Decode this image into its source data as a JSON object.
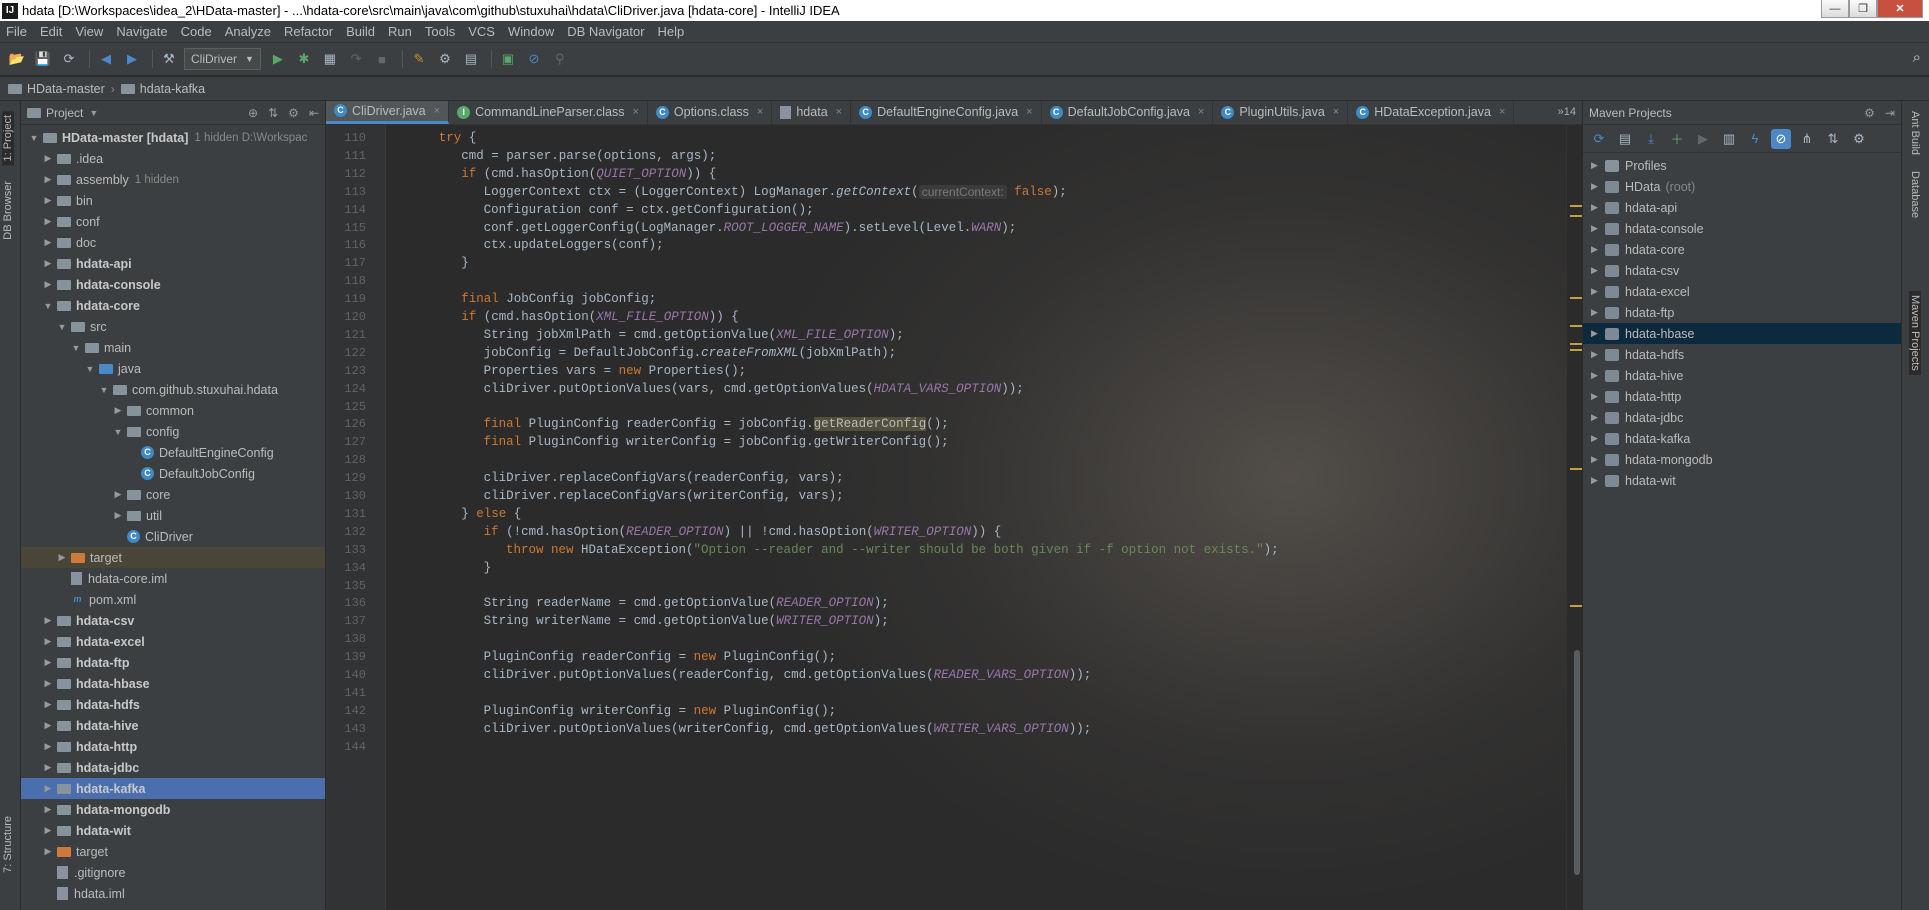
{
  "window": {
    "title": "hdata [D:\\Workspaces\\idea_2\\HData-master] - ...\\hdata-core\\src\\main\\java\\com\\github\\stuxuhai\\hdata\\CliDriver.java [hdata-core] - IntelliJ IDEA",
    "app_icon": "IJ",
    "minimize": "—",
    "maximize": "❐",
    "close": "✕"
  },
  "menu": [
    "File",
    "Edit",
    "View",
    "Navigate",
    "Code",
    "Analyze",
    "Refactor",
    "Build",
    "Run",
    "Tools",
    "VCS",
    "Window",
    "DB Navigator",
    "Help"
  ],
  "toolbar": {
    "run_config": "CliDriver",
    "icons": [
      "open-folder-icon",
      "save-icon",
      "sync-icon",
      "back-arrow-icon",
      "forward-arrow-icon",
      "build-icon",
      "run-icon",
      "debug-icon",
      "coverage-icon",
      "profile-icon",
      "stop-icon",
      "vcs-update-icon",
      "vcs-commit-icon",
      "project-structure-icon",
      "sdk-icon",
      "terminal-icon"
    ],
    "search_glyph": "⌕"
  },
  "breadcrumb": [
    "HData-master",
    "hdata-kafka"
  ],
  "left_strip": {
    "project_tab": "1: Project",
    "db_browser": "DB Browser",
    "structure": "7: Structure"
  },
  "project": {
    "header": "Project",
    "tree": [
      {
        "label": "HData-master [hdata]",
        "meta": "1 hidden  D:\\Workspac",
        "indent": 0,
        "arrow": "▼",
        "bold": true,
        "icon": "folder"
      },
      {
        "label": ".idea",
        "indent": 1,
        "arrow": "▶",
        "icon": "folder"
      },
      {
        "label": "assembly",
        "meta": "1 hidden",
        "indent": 1,
        "arrow": "▶",
        "icon": "folder"
      },
      {
        "label": "bin",
        "indent": 1,
        "arrow": "▶",
        "icon": "folder"
      },
      {
        "label": "conf",
        "indent": 1,
        "arrow": "▶",
        "icon": "folder"
      },
      {
        "label": "doc",
        "indent": 1,
        "arrow": "▶",
        "icon": "folder"
      },
      {
        "label": "hdata-api",
        "indent": 1,
        "arrow": "▶",
        "bold": true,
        "icon": "folder"
      },
      {
        "label": "hdata-console",
        "indent": 1,
        "arrow": "▶",
        "bold": true,
        "icon": "folder"
      },
      {
        "label": "hdata-core",
        "indent": 1,
        "arrow": "▼",
        "bold": true,
        "icon": "folder"
      },
      {
        "label": "src",
        "indent": 2,
        "arrow": "▼",
        "icon": "folder"
      },
      {
        "label": "main",
        "indent": 3,
        "arrow": "▼",
        "icon": "folder"
      },
      {
        "label": "java",
        "indent": 4,
        "arrow": "▼",
        "icon": "folder-blue"
      },
      {
        "label": "com.github.stuxuhai.hdata",
        "indent": 5,
        "arrow": "▼",
        "icon": "folder"
      },
      {
        "label": "common",
        "indent": 6,
        "arrow": "▶",
        "icon": "folder"
      },
      {
        "label": "config",
        "indent": 6,
        "arrow": "▼",
        "icon": "folder"
      },
      {
        "label": "DefaultEngineConfig",
        "indent": 7,
        "arrow": "",
        "icon": "class"
      },
      {
        "label": "DefaultJobConfig",
        "indent": 7,
        "arrow": "",
        "icon": "class"
      },
      {
        "label": "core",
        "indent": 6,
        "arrow": "▶",
        "icon": "folder"
      },
      {
        "label": "util",
        "indent": 6,
        "arrow": "▶",
        "icon": "folder"
      },
      {
        "label": "CliDriver",
        "indent": 6,
        "arrow": "",
        "icon": "class"
      },
      {
        "label": "target",
        "indent": 2,
        "arrow": "▶",
        "icon": "folder-orange",
        "state": "target"
      },
      {
        "label": "hdata-core.iml",
        "indent": 2,
        "arrow": "",
        "icon": "file"
      },
      {
        "label": "pom.xml",
        "indent": 2,
        "arrow": "",
        "icon": "maven"
      },
      {
        "label": "hdata-csv",
        "indent": 1,
        "arrow": "▶",
        "bold": true,
        "icon": "folder"
      },
      {
        "label": "hdata-excel",
        "indent": 1,
        "arrow": "▶",
        "bold": true,
        "icon": "folder"
      },
      {
        "label": "hdata-ftp",
        "indent": 1,
        "arrow": "▶",
        "bold": true,
        "icon": "folder"
      },
      {
        "label": "hdata-hbase",
        "indent": 1,
        "arrow": "▶",
        "bold": true,
        "icon": "folder"
      },
      {
        "label": "hdata-hdfs",
        "indent": 1,
        "arrow": "▶",
        "bold": true,
        "icon": "folder"
      },
      {
        "label": "hdata-hive",
        "indent": 1,
        "arrow": "▶",
        "bold": true,
        "icon": "folder"
      },
      {
        "label": "hdata-http",
        "indent": 1,
        "arrow": "▶",
        "bold": true,
        "icon": "folder"
      },
      {
        "label": "hdata-jdbc",
        "indent": 1,
        "arrow": "▶",
        "bold": true,
        "icon": "folder"
      },
      {
        "label": "hdata-kafka",
        "indent": 1,
        "arrow": "▶",
        "bold": true,
        "icon": "folder",
        "state": "selected"
      },
      {
        "label": "hdata-mongodb",
        "indent": 1,
        "arrow": "▶",
        "bold": true,
        "icon": "folder"
      },
      {
        "label": "hdata-wit",
        "indent": 1,
        "arrow": "▶",
        "bold": true,
        "icon": "folder"
      },
      {
        "label": "target",
        "indent": 1,
        "arrow": "▶",
        "icon": "folder-orange"
      },
      {
        "label": ".gitignore",
        "indent": 1,
        "arrow": "",
        "icon": "file"
      },
      {
        "label": "hdata.iml",
        "indent": 1,
        "arrow": "",
        "icon": "file"
      }
    ]
  },
  "tabs": [
    {
      "label": "CliDriver.java",
      "active": true,
      "icon": "class"
    },
    {
      "label": "CommandLineParser.class",
      "icon": "interface"
    },
    {
      "label": "Options.class",
      "icon": "class"
    },
    {
      "label": "hdata",
      "icon": "file"
    },
    {
      "label": "DefaultEngineConfig.java",
      "icon": "class"
    },
    {
      "label": "DefaultJobConfig.java",
      "icon": "class"
    },
    {
      "label": "PluginUtils.java",
      "icon": "class"
    },
    {
      "label": "HDataException.java",
      "icon": "class"
    }
  ],
  "tabs_overflow": "»14",
  "editor": {
    "lines": [
      {
        "n": "110",
        "indent": 4,
        "tokens": [
          [
            "kw",
            "try"
          ],
          [
            "plain",
            " {"
          ]
        ]
      },
      {
        "n": "111",
        "indent": 6,
        "tokens": [
          [
            "plain",
            "cmd = parser.parse(options, args);"
          ]
        ]
      },
      {
        "n": "112",
        "indent": 6,
        "tokens": [
          [
            "kw",
            "if"
          ],
          [
            "plain",
            " (cmd.hasOption("
          ],
          [
            "cn",
            "QUIET_OPTION"
          ],
          [
            "plain",
            ")) {"
          ]
        ]
      },
      {
        "n": "113",
        "indent": 8,
        "tokens": [
          [
            "plain",
            "LoggerContext ctx = (LoggerContext) LogManager."
          ],
          [
            "fn",
            "getContext"
          ],
          [
            "plain",
            "("
          ],
          [
            "hint",
            "currentContext:"
          ],
          [
            "kw",
            " false"
          ],
          [
            "plain",
            ");"
          ]
        ]
      },
      {
        "n": "114",
        "indent": 8,
        "tokens": [
          [
            "plain",
            "Configuration conf = ctx.getConfiguration();"
          ]
        ]
      },
      {
        "n": "115",
        "indent": 8,
        "tokens": [
          [
            "plain",
            "conf.getLoggerConfig(LogManager."
          ],
          [
            "cn",
            "ROOT_LOGGER_NAME"
          ],
          [
            "plain",
            ").setLevel(Level."
          ],
          [
            "cn",
            "WARN"
          ],
          [
            "plain",
            ");"
          ]
        ]
      },
      {
        "n": "116",
        "indent": 8,
        "tokens": [
          [
            "plain",
            "ctx.updateLoggers(conf);"
          ]
        ]
      },
      {
        "n": "117",
        "indent": 6,
        "tokens": [
          [
            "plain",
            "}"
          ]
        ]
      },
      {
        "n": "118",
        "indent": 0,
        "tokens": []
      },
      {
        "n": "119",
        "indent": 6,
        "tokens": [
          [
            "kw",
            "final"
          ],
          [
            "plain",
            " JobConfig jobConfig;"
          ]
        ]
      },
      {
        "n": "120",
        "indent": 6,
        "tokens": [
          [
            "kw",
            "if"
          ],
          [
            "plain",
            " (cmd.hasOption("
          ],
          [
            "cn",
            "XML_FILE_OPTION"
          ],
          [
            "plain",
            ")) {"
          ]
        ]
      },
      {
        "n": "121",
        "indent": 8,
        "tokens": [
          [
            "plain",
            "String jobXmlPath = cmd.getOptionValue("
          ],
          [
            "cn",
            "XML_FILE_OPTION"
          ],
          [
            "plain",
            ");"
          ]
        ]
      },
      {
        "n": "122",
        "indent": 8,
        "tokens": [
          [
            "plain",
            "jobConfig = DefaultJobConfig."
          ],
          [
            "fn",
            "createFromXML"
          ],
          [
            "plain",
            "(jobXmlPath);"
          ]
        ]
      },
      {
        "n": "123",
        "indent": 8,
        "tokens": [
          [
            "plain",
            "Properties vars = "
          ],
          [
            "kw",
            "new"
          ],
          [
            "plain",
            " Properties();"
          ]
        ]
      },
      {
        "n": "124",
        "indent": 8,
        "tokens": [
          [
            "plain",
            "cliDriver.putOptionValues(vars, cmd.getOptionValues("
          ],
          [
            "cn",
            "HDATA_VARS_OPTION"
          ],
          [
            "plain",
            "));"
          ]
        ]
      },
      {
        "n": "125",
        "indent": 0,
        "tokens": []
      },
      {
        "n": "126",
        "indent": 8,
        "tokens": [
          [
            "kw",
            "final"
          ],
          [
            "plain",
            " PluginConfig readerConfig = jobConfig."
          ],
          [
            "hl",
            "getReaderConfig"
          ],
          [
            "plain",
            "();"
          ]
        ]
      },
      {
        "n": "127",
        "indent": 8,
        "tokens": [
          [
            "kw",
            "final"
          ],
          [
            "plain",
            " PluginConfig writerConfig = jobConfig.getWriterConfig();"
          ]
        ]
      },
      {
        "n": "128",
        "indent": 0,
        "tokens": []
      },
      {
        "n": "129",
        "indent": 8,
        "tokens": [
          [
            "plain",
            "cliDriver.replaceConfigVars(readerConfig, vars);"
          ]
        ]
      },
      {
        "n": "130",
        "indent": 8,
        "tokens": [
          [
            "plain",
            "cliDriver.replaceConfigVars(writerConfig, vars);"
          ]
        ]
      },
      {
        "n": "131",
        "indent": 6,
        "tokens": [
          [
            "plain",
            "} "
          ],
          [
            "kw",
            "else"
          ],
          [
            "plain",
            " {"
          ]
        ]
      },
      {
        "n": "132",
        "indent": 8,
        "tokens": [
          [
            "kw",
            "if"
          ],
          [
            "plain",
            " (!cmd.hasOption("
          ],
          [
            "cn",
            "READER_OPTION"
          ],
          [
            "plain",
            ") || !cmd.hasOption("
          ],
          [
            "cn",
            "WRITER_OPTION"
          ],
          [
            "plain",
            ")) {"
          ]
        ]
      },
      {
        "n": "133",
        "indent": 10,
        "tokens": [
          [
            "kw",
            "throw new"
          ],
          [
            "plain",
            " HDataException("
          ],
          [
            "str",
            "\"Option --reader and --writer should be both given if -f option not exists.\""
          ],
          [
            "plain",
            ");"
          ]
        ]
      },
      {
        "n": "134",
        "indent": 8,
        "tokens": [
          [
            "plain",
            "}"
          ]
        ]
      },
      {
        "n": "135",
        "indent": 0,
        "tokens": []
      },
      {
        "n": "136",
        "indent": 8,
        "tokens": [
          [
            "plain",
            "String readerName = cmd.getOptionValue("
          ],
          [
            "cn",
            "READER_OPTION"
          ],
          [
            "plain",
            ");"
          ]
        ]
      },
      {
        "n": "137",
        "indent": 8,
        "tokens": [
          [
            "plain",
            "String writerName = cmd.getOptionValue("
          ],
          [
            "cn",
            "WRITER_OPTION"
          ],
          [
            "plain",
            ");"
          ]
        ]
      },
      {
        "n": "138",
        "indent": 0,
        "tokens": []
      },
      {
        "n": "139",
        "indent": 8,
        "tokens": [
          [
            "plain",
            "PluginConfig readerConfig = "
          ],
          [
            "kw",
            "new"
          ],
          [
            "plain",
            " PluginConfig();"
          ]
        ]
      },
      {
        "n": "140",
        "indent": 8,
        "tokens": [
          [
            "plain",
            "cliDriver.putOptionValues(readerConfig, cmd.getOptionValues("
          ],
          [
            "cn",
            "READER_VARS_OPTION"
          ],
          [
            "plain",
            "));"
          ]
        ]
      },
      {
        "n": "141",
        "indent": 0,
        "tokens": []
      },
      {
        "n": "142",
        "indent": 8,
        "tokens": [
          [
            "plain",
            "PluginConfig writerConfig = "
          ],
          [
            "kw",
            "new"
          ],
          [
            "plain",
            " PluginConfig();"
          ]
        ]
      },
      {
        "n": "143",
        "indent": 8,
        "tokens": [
          [
            "plain",
            "cliDriver.putOptionValues(writerConfig, cmd.getOptionValues("
          ],
          [
            "cn",
            "WRITER_VARS_OPTION"
          ],
          [
            "plain",
            "));"
          ]
        ]
      },
      {
        "n": "144",
        "indent": 0,
        "tokens": []
      }
    ]
  },
  "maven": {
    "header": "Maven Projects",
    "items": [
      {
        "label": "Profiles",
        "arrow": "▶",
        "icon": "folder"
      },
      {
        "label": "HData",
        "meta": "(root)",
        "arrow": "▶",
        "icon": "maven"
      },
      {
        "label": "hdata-api",
        "arrow": "▶",
        "icon": "maven"
      },
      {
        "label": "hdata-console",
        "arrow": "▶",
        "icon": "maven"
      },
      {
        "label": "hdata-core",
        "arrow": "▶",
        "icon": "maven"
      },
      {
        "label": "hdata-csv",
        "arrow": "▶",
        "icon": "maven"
      },
      {
        "label": "hdata-excel",
        "arrow": "▶",
        "icon": "maven"
      },
      {
        "label": "hdata-ftp",
        "arrow": "▶",
        "icon": "maven"
      },
      {
        "label": "hdata-hbase",
        "arrow": "▶",
        "icon": "maven",
        "selected": true
      },
      {
        "label": "hdata-hdfs",
        "arrow": "▶",
        "icon": "maven"
      },
      {
        "label": "hdata-hive",
        "arrow": "▶",
        "icon": "maven"
      },
      {
        "label": "hdata-http",
        "arrow": "▶",
        "icon": "maven"
      },
      {
        "label": "hdata-jdbc",
        "arrow": "▶",
        "icon": "maven"
      },
      {
        "label": "hdata-kafka",
        "arrow": "▶",
        "icon": "maven"
      },
      {
        "label": "hdata-mongodb",
        "arrow": "▶",
        "icon": "maven"
      },
      {
        "label": "hdata-wit",
        "arrow": "▶",
        "icon": "maven"
      }
    ]
  },
  "right_strip": {
    "ant": "Ant Build",
    "database": "Database",
    "maven": "Maven Projects"
  },
  "colors": {
    "accent": "#4a88c7",
    "keyword": "#cc7832",
    "constant": "#9876aa",
    "string": "#6a8759",
    "selection": "#4b6eaf"
  }
}
